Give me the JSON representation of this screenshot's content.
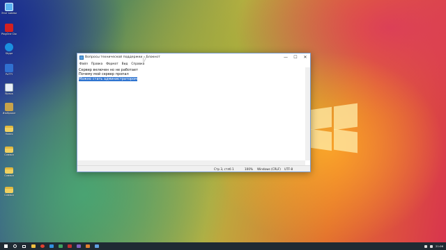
{
  "desktop": {
    "icons": [
      {
        "label": "Этот компьютер",
        "icon": "computer-icon"
      },
      {
        "label": "PingOne Cloud",
        "icon": "pdf-app-icon"
      },
      {
        "label": "Skype",
        "icon": "skype-icon"
      },
      {
        "label": "PuTTY",
        "icon": "putty-icon"
      },
      {
        "label": "Ярлык",
        "icon": "file-icon"
      },
      {
        "label": "Изображе",
        "icon": "document-icon"
      },
      {
        "label": "Новая",
        "icon": "folder-icon"
      },
      {
        "label": "Символ",
        "icon": "folder-icon"
      },
      {
        "label": "Символ",
        "icon": "folder-icon"
      },
      {
        "label": "Символ",
        "icon": "folder-icon"
      }
    ]
  },
  "window": {
    "title": "Вопросы технической поддержки – Блокнот",
    "controls": {
      "minimize": "—",
      "maximize": "☐",
      "close": "✕"
    },
    "menu": [
      "Файл",
      "Правка",
      "Формат",
      "Вид",
      "Справка"
    ],
    "lines": [
      {
        "text": "Сервер включен но не работает",
        "selected": false
      },
      {
        "text": "Почему мой сервер пропал",
        "selected": false
      },
      {
        "text": "Можно стать администратором",
        "selected": true
      }
    ],
    "status": {
      "position": "Стр 3, стлб 1",
      "zoom": "100%",
      "line_ending": "Windows (CRLF)",
      "encoding": "UTF-8"
    }
  },
  "taskbar": {
    "clock": "21:06",
    "apps": [
      {
        "icon": "file-explorer-icon",
        "color": "#f0c040"
      },
      {
        "icon": "chrome-icon",
        "color": "#e04030"
      },
      {
        "icon": "app-icon",
        "color": "#3090e0"
      },
      {
        "icon": "app-icon",
        "color": "#40a060"
      },
      {
        "icon": "app-icon",
        "color": "#c03030"
      },
      {
        "icon": "app-icon",
        "color": "#8060c0"
      },
      {
        "icon": "app-icon",
        "color": "#e08030"
      },
      {
        "icon": "notepad-icon",
        "color": "#60a0e0"
      }
    ]
  }
}
